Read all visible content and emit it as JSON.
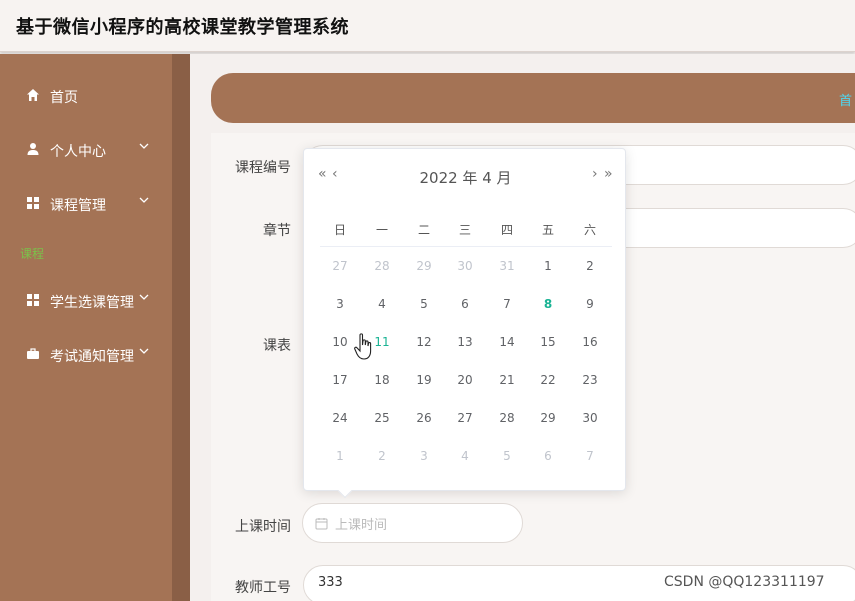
{
  "header": {
    "title": "基于微信小程序的高校课堂教学管理系统"
  },
  "sidebar": {
    "items": [
      {
        "label": "首页",
        "icon": "home-icon",
        "has_chevron": false
      },
      {
        "label": "个人中心",
        "icon": "user-icon",
        "has_chevron": true
      },
      {
        "label": "课程管理",
        "icon": "grid-icon",
        "has_chevron": true
      },
      {
        "label": "学生选课管理",
        "icon": "grid-icon",
        "has_chevron": true
      },
      {
        "label": "考试通知管理",
        "icon": "briefcase-icon",
        "has_chevron": true
      }
    ],
    "sub_label": "课程"
  },
  "breadcrumb": {
    "label": "首"
  },
  "form": {
    "course_no_label": "课程编号",
    "chapter_label": "章节",
    "schedule_label": "课表",
    "time_label": "上课时间",
    "time_placeholder": "上课时间",
    "teacher_label": "教师工号",
    "teacher_value": "333"
  },
  "datepicker": {
    "year_month": "2022 年  4 月",
    "prev_year": "«",
    "prev_month": "‹",
    "next_month": "›",
    "next_year": "»",
    "weekdays": [
      "日",
      "一",
      "二",
      "三",
      "四",
      "五",
      "六"
    ],
    "weeks": [
      [
        [
          "27",
          "other"
        ],
        [
          "28",
          "other"
        ],
        [
          "29",
          "other"
        ],
        [
          "30",
          "other"
        ],
        [
          "31",
          "other"
        ],
        [
          "1",
          ""
        ],
        [
          "2",
          ""
        ]
      ],
      [
        [
          "3",
          ""
        ],
        [
          "4",
          ""
        ],
        [
          "5",
          ""
        ],
        [
          "6",
          ""
        ],
        [
          "7",
          ""
        ],
        [
          "8",
          "today"
        ],
        [
          "9",
          ""
        ]
      ],
      [
        [
          "10",
          ""
        ],
        [
          "11",
          "hover"
        ],
        [
          "12",
          ""
        ],
        [
          "13",
          ""
        ],
        [
          "14",
          ""
        ],
        [
          "15",
          ""
        ],
        [
          "16",
          ""
        ]
      ],
      [
        [
          "17",
          ""
        ],
        [
          "18",
          ""
        ],
        [
          "19",
          ""
        ],
        [
          "20",
          ""
        ],
        [
          "21",
          ""
        ],
        [
          "22",
          ""
        ],
        [
          "23",
          ""
        ]
      ],
      [
        [
          "24",
          ""
        ],
        [
          "25",
          ""
        ],
        [
          "26",
          ""
        ],
        [
          "27",
          ""
        ],
        [
          "28",
          ""
        ],
        [
          "29",
          ""
        ],
        [
          "30",
          ""
        ]
      ],
      [
        [
          "1",
          "other"
        ],
        [
          "2",
          "other"
        ],
        [
          "3",
          "other"
        ],
        [
          "4",
          "other"
        ],
        [
          "5",
          "other"
        ],
        [
          "6",
          "other"
        ],
        [
          "7",
          "other"
        ]
      ]
    ]
  },
  "watermark": "CSDN @QQ123311197",
  "colors": {
    "sidebar": "#a47355",
    "accent": "#1ab394",
    "crumb": "#4fd6f0"
  }
}
